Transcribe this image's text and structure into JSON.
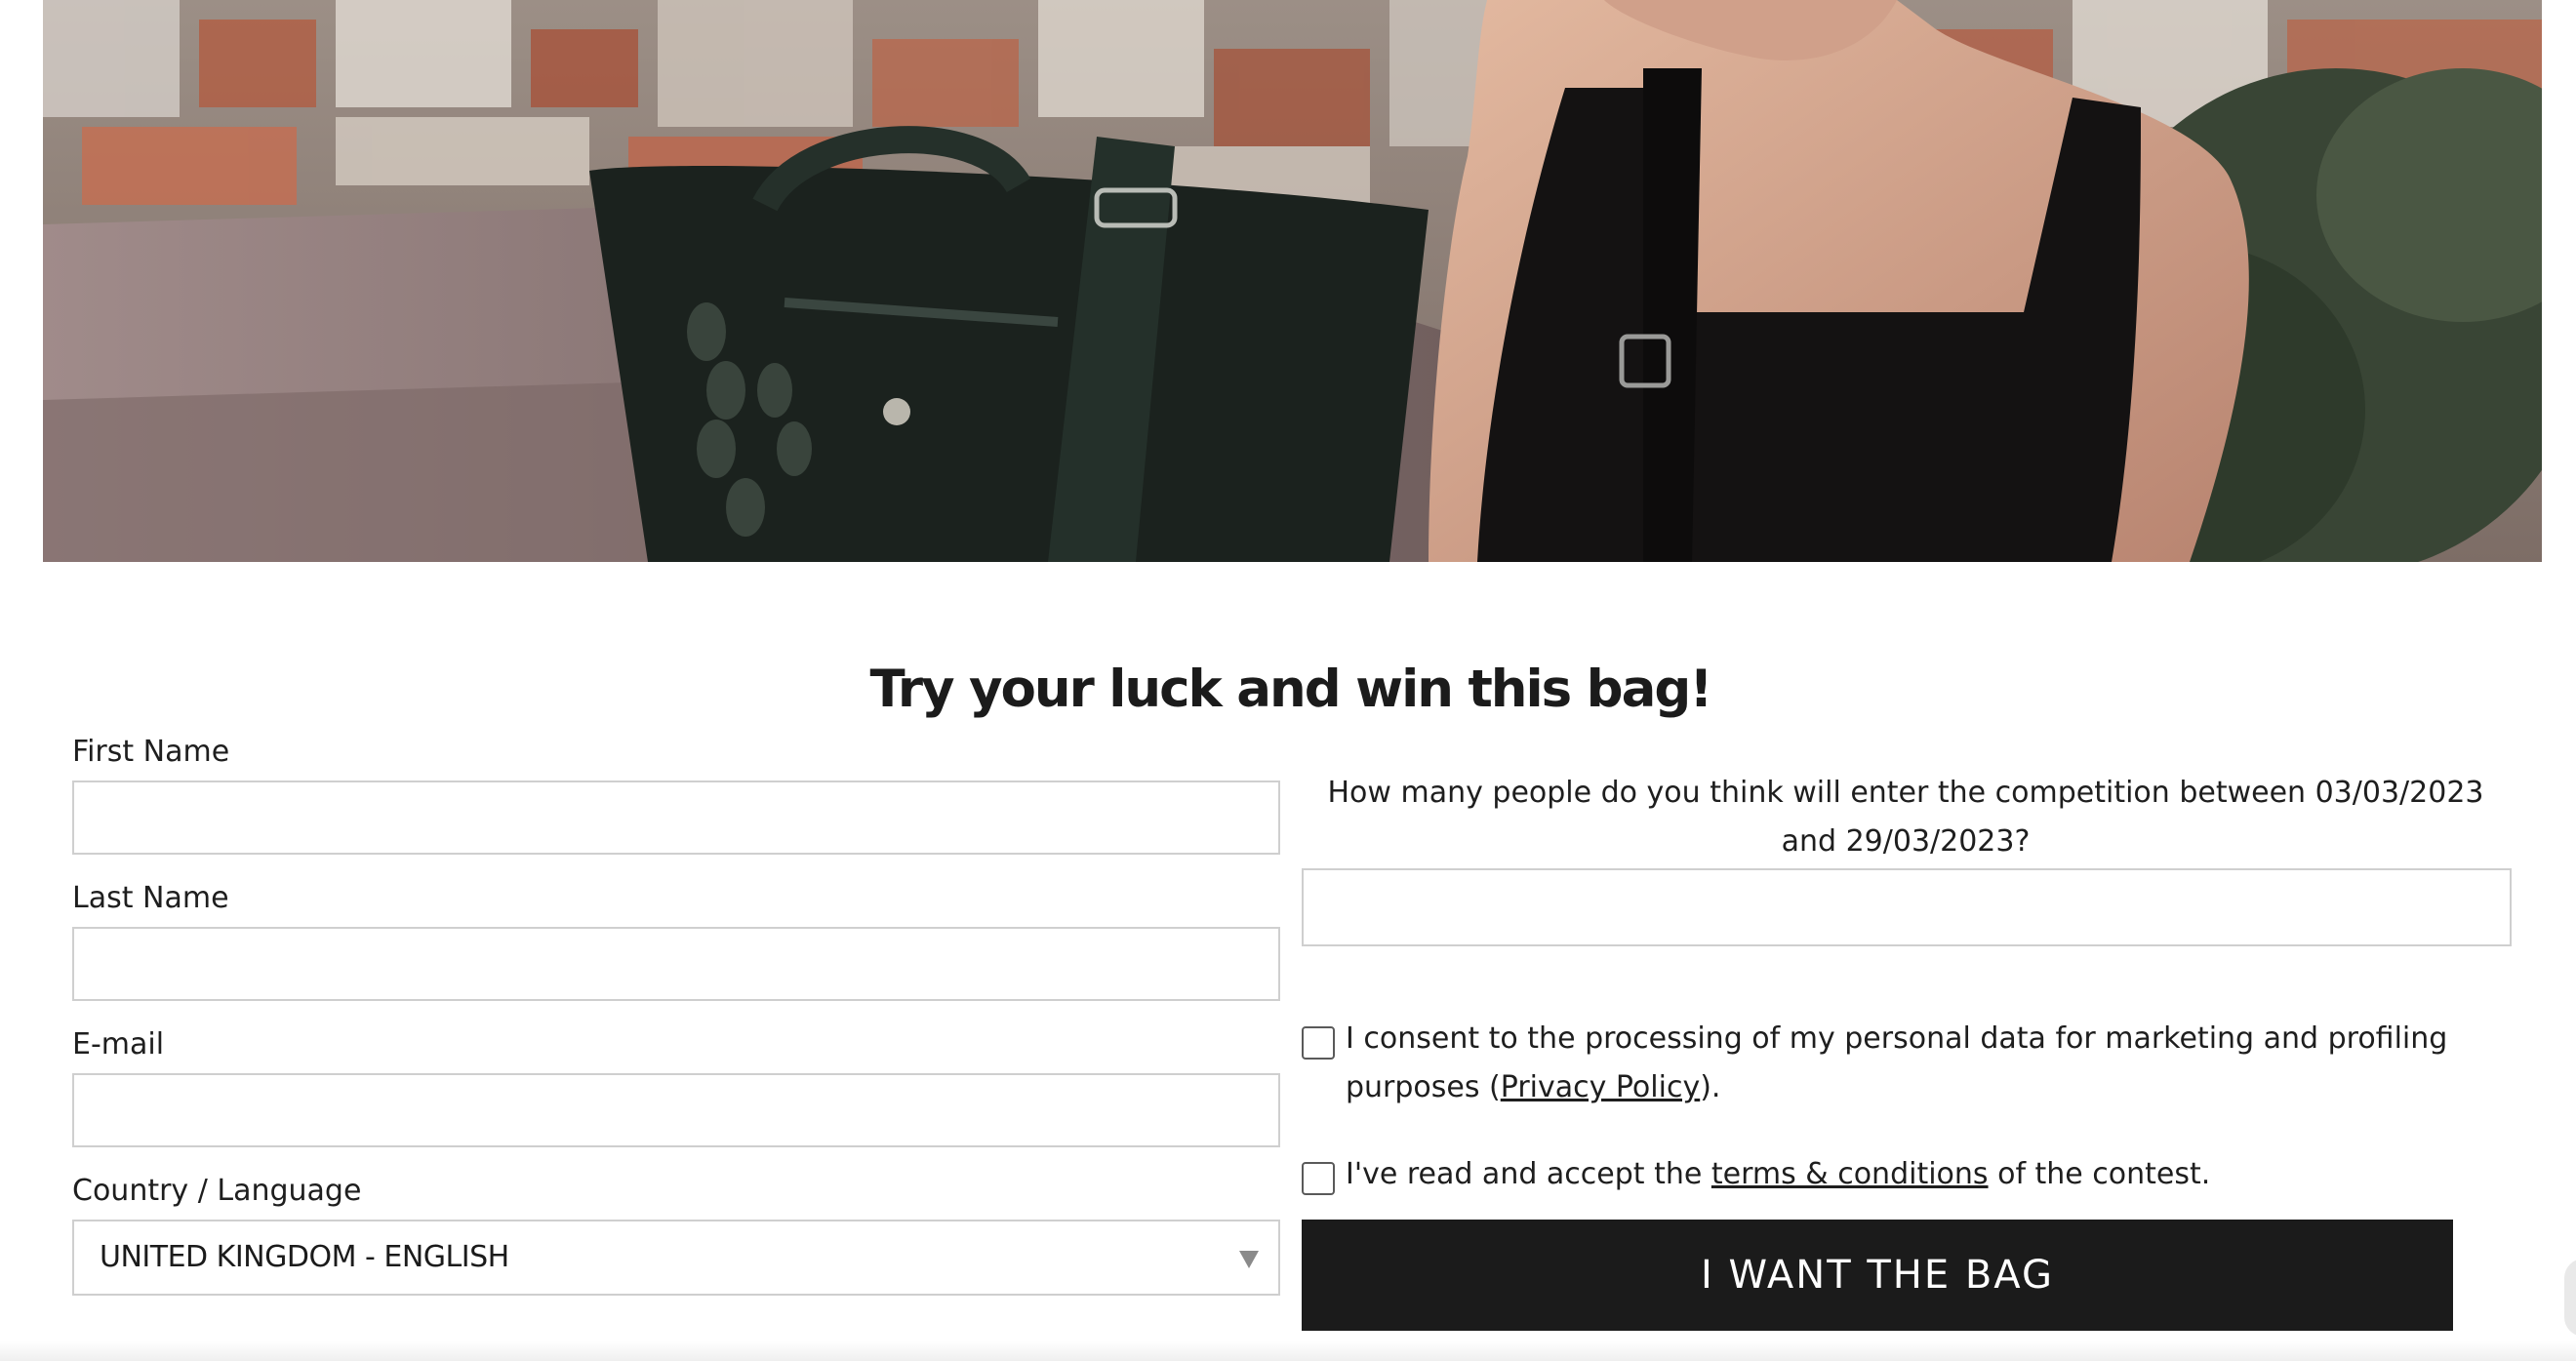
{
  "hero": {
    "image": "promo-photo-woman-with-black-bag",
    "colors": {
      "sky": "#8d7f76",
      "wall": "#8a7676",
      "bag": "#1b221e",
      "top": "#141212"
    }
  },
  "form": {
    "title": "Try your luck and win this bag!",
    "first_name": {
      "label": "First Name",
      "value": ""
    },
    "last_name": {
      "label": "Last Name",
      "value": ""
    },
    "email": {
      "label": "E-mail",
      "value": ""
    },
    "country": {
      "label": "Country / Language",
      "selected": "UNITED KINGDOM - ENGLISH",
      "icon": "chevron-down-icon"
    },
    "question": {
      "text": "How many people do you think will enter the competition between 03/03/2023 and 29/03/2023?",
      "value": ""
    },
    "consent": {
      "before": "I consent to the processing of my personal data for marketing and profiling purposes (",
      "link": "Privacy Policy",
      "after": ").",
      "checked": false
    },
    "terms": {
      "before": "I've read and accept the ",
      "link": "terms & conditions",
      "after": " of the contest.",
      "checked": false
    },
    "submit_label": "I WANT THE BAG",
    "accent": "#1b1b1b"
  }
}
